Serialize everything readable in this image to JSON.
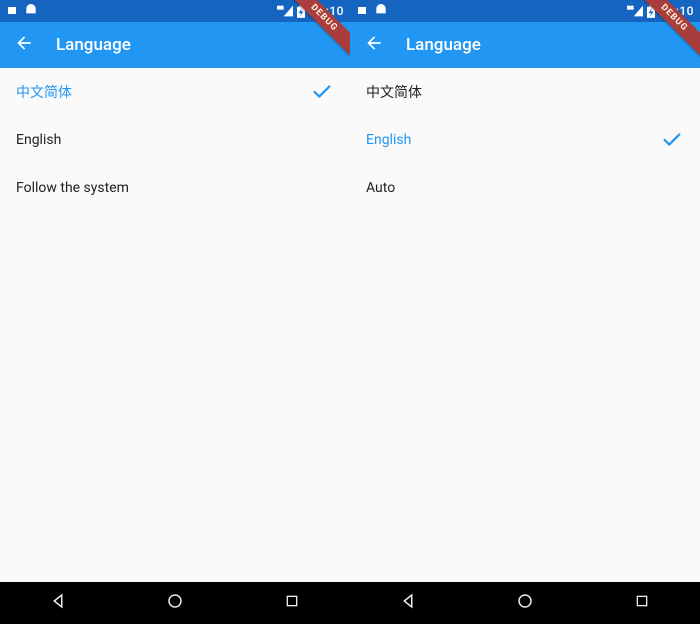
{
  "left_panel": {
    "status": {
      "time": "10:10"
    },
    "app_bar": {
      "title": "Language"
    },
    "debug_label": "DEBUG",
    "items": [
      {
        "label": "中文简体",
        "selected": true
      },
      {
        "label": "English",
        "selected": false
      },
      {
        "label": "Follow the system",
        "selected": false
      }
    ]
  },
  "right_panel": {
    "status": {
      "time": "10:10"
    },
    "app_bar": {
      "title": "Language"
    },
    "debug_label": "DEBUG",
    "items": [
      {
        "label": "中文简体",
        "selected": false
      },
      {
        "label": "English",
        "selected": true
      },
      {
        "label": "Auto",
        "selected": false
      }
    ]
  }
}
